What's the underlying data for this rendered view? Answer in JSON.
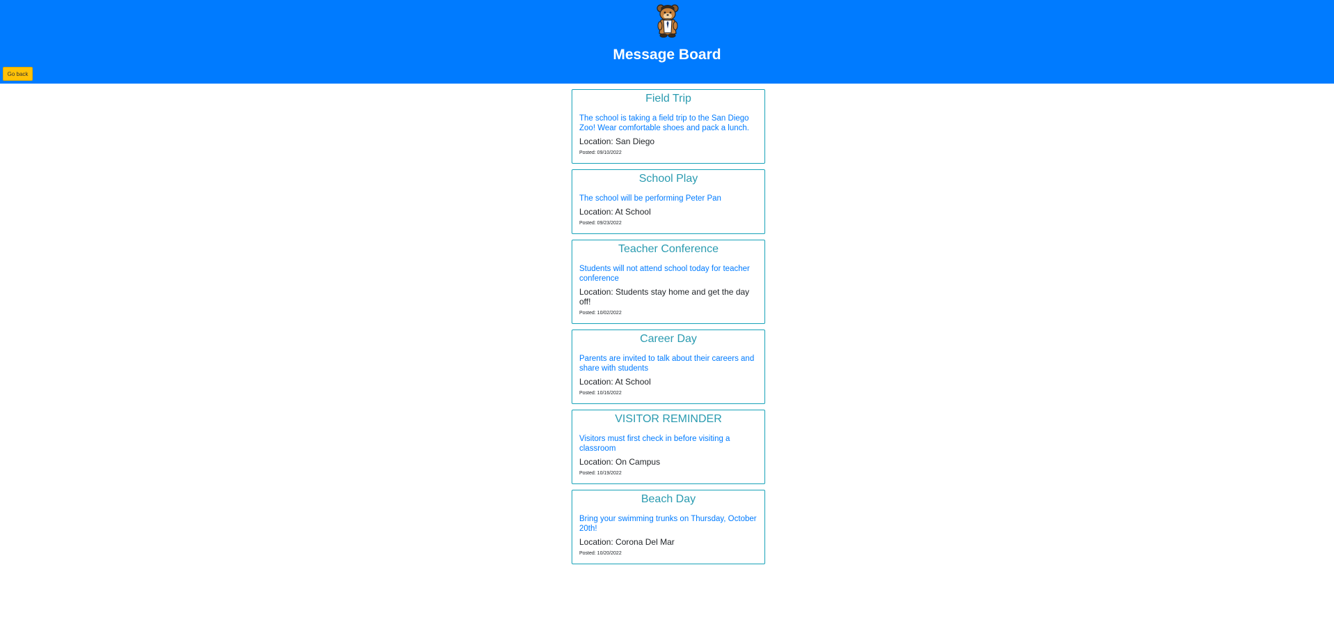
{
  "header": {
    "title": "Message Board",
    "back_button": "Go back",
    "background_color": "#007bff",
    "mascot_icon": "mascot-logo"
  },
  "posts": [
    {
      "title": "Field Trip",
      "description": "The school is taking a field trip to the San Diego Zoo! Wear comfortable shoes and pack a lunch.",
      "location": "Location: San Diego",
      "posted": "Posted: 09/10/2022"
    },
    {
      "title": "School Play",
      "description": "The school will be performing Peter Pan",
      "location": "Location: At School",
      "posted": "Posted: 09/23/2022"
    },
    {
      "title": "Teacher Conference",
      "description": "Students will not attend school today for teacher conference",
      "location": "Location: Students stay home and get the day off!",
      "posted": "Posted: 10/02/2022"
    },
    {
      "title": "Career Day",
      "description": "Parents are invited to talk about their careers and share with students",
      "location": "Location: At School",
      "posted": "Posted: 10/16/2022"
    },
    {
      "title": "VISITOR REMINDER",
      "description": "Visitors must first check in before visiting a classroom",
      "location": "Location: On Campus",
      "posted": "Posted: 10/19/2022"
    },
    {
      "title": "Beach Day",
      "description": "Bring your swimming trunks on Thursday, October 20th!",
      "location": "Location: Corona Del Mar",
      "posted": "Posted: 10/20/2022"
    }
  ]
}
